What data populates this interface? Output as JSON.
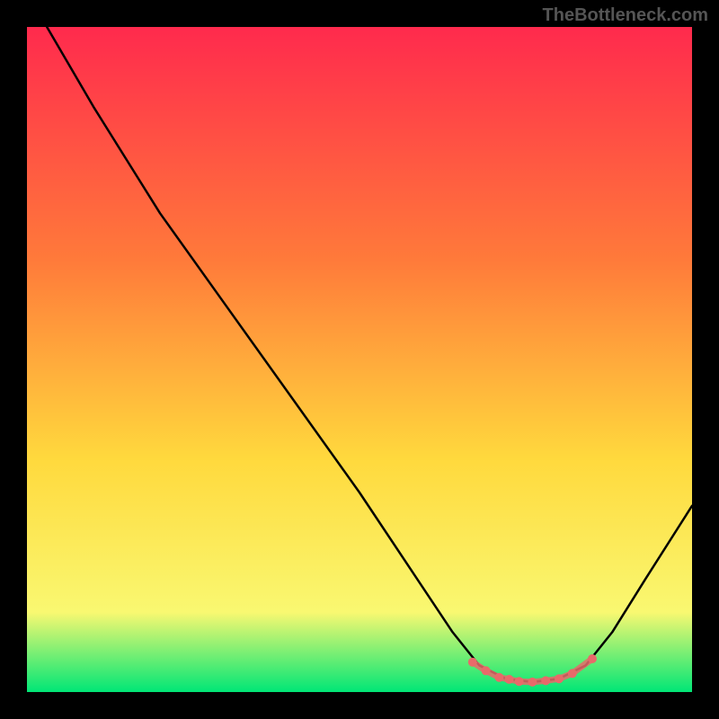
{
  "watermark": "TheBottleneck.com",
  "chart_data": {
    "type": "line",
    "title": "",
    "xlabel": "",
    "ylabel": "",
    "xlim": [
      0,
      100
    ],
    "ylim": [
      0,
      100
    ],
    "gradient_colors": {
      "top": "#ff2a4d",
      "mid1": "#ff7a3a",
      "mid2": "#ffd93d",
      "mid3": "#f9f871",
      "bottom": "#00e676"
    },
    "curve": [
      {
        "x": 3,
        "y": 100
      },
      {
        "x": 10,
        "y": 88
      },
      {
        "x": 15,
        "y": 80
      },
      {
        "x": 20,
        "y": 72
      },
      {
        "x": 30,
        "y": 58
      },
      {
        "x": 40,
        "y": 44
      },
      {
        "x": 50,
        "y": 30
      },
      {
        "x": 58,
        "y": 18
      },
      {
        "x": 64,
        "y": 9
      },
      {
        "x": 68,
        "y": 4
      },
      {
        "x": 72,
        "y": 2
      },
      {
        "x": 76,
        "y": 1.5
      },
      {
        "x": 80,
        "y": 2
      },
      {
        "x": 84,
        "y": 4
      },
      {
        "x": 88,
        "y": 9
      },
      {
        "x": 93,
        "y": 17
      },
      {
        "x": 100,
        "y": 28
      }
    ],
    "highlight_points": [
      {
        "x": 67,
        "y": 4.5
      },
      {
        "x": 69,
        "y": 3.2
      },
      {
        "x": 71,
        "y": 2.2
      },
      {
        "x": 72.5,
        "y": 1.9
      },
      {
        "x": 74,
        "y": 1.6
      },
      {
        "x": 76,
        "y": 1.5
      },
      {
        "x": 78,
        "y": 1.7
      },
      {
        "x": 80,
        "y": 2.0
      },
      {
        "x": 82,
        "y": 2.8
      },
      {
        "x": 85,
        "y": 5.0
      }
    ],
    "highlight_color": "#e86a6a"
  }
}
